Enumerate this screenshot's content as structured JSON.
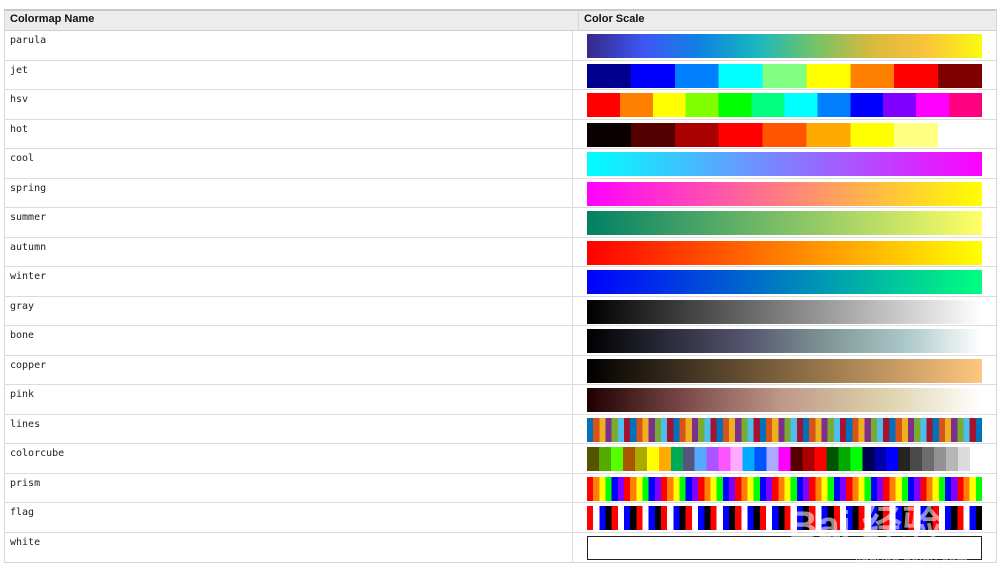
{
  "headers": {
    "name": "Colormap Name",
    "scale": "Color Scale"
  },
  "colormaps": [
    {
      "name": "parula",
      "kind": "gradient",
      "stops": [
        "#352a87",
        "#3e56f4",
        "#0f83e2",
        "#19b6c0",
        "#6fc46b",
        "#d5b93d",
        "#fbc33b",
        "#f9fb0e"
      ]
    },
    {
      "name": "jet",
      "kind": "stepped",
      "stops": [
        "#00008f",
        "#0000ff",
        "#0080ff",
        "#00ffff",
        "#80ff80",
        "#ffff00",
        "#ff8000",
        "#ff0000",
        "#800000"
      ]
    },
    {
      "name": "hsv",
      "kind": "stepped",
      "stops": [
        "#ff0000",
        "#ff8000",
        "#ffff00",
        "#80ff00",
        "#00ff00",
        "#00ff80",
        "#00ffff",
        "#0080ff",
        "#0000ff",
        "#8000ff",
        "#ff00ff",
        "#ff0080"
      ]
    },
    {
      "name": "hot",
      "kind": "stepped",
      "stops": [
        "#0b0000",
        "#550000",
        "#aa0000",
        "#ff0000",
        "#ff5500",
        "#ffaa00",
        "#ffff00",
        "#ffff80",
        "#ffffff"
      ]
    },
    {
      "name": "cool",
      "kind": "gradient",
      "stops": [
        "#00ffff",
        "#ff00ff"
      ]
    },
    {
      "name": "spring",
      "kind": "gradient",
      "stops": [
        "#ff00ff",
        "#ffff00"
      ]
    },
    {
      "name": "summer",
      "kind": "gradient",
      "stops": [
        "#008066",
        "#ffff66"
      ]
    },
    {
      "name": "autumn",
      "kind": "gradient",
      "stops": [
        "#ff0000",
        "#ffff00"
      ]
    },
    {
      "name": "winter",
      "kind": "gradient",
      "stops": [
        "#0000ff",
        "#00ff80"
      ]
    },
    {
      "name": "gray",
      "kind": "gradient",
      "stops": [
        "#000000",
        "#ffffff"
      ]
    },
    {
      "name": "bone",
      "kind": "gradient",
      "stops": [
        "#000000",
        "#2a2a3a",
        "#54546f",
        "#7e9494",
        "#a9c6c6",
        "#ffffff"
      ]
    },
    {
      "name": "copper",
      "kind": "gradient",
      "stops": [
        "#000000",
        "#ffc77f"
      ]
    },
    {
      "name": "pink",
      "kind": "gradient",
      "stops": [
        "#1e0000",
        "#7c4a4a",
        "#c09a8a",
        "#dcd1aa",
        "#ffffff"
      ]
    },
    {
      "name": "lines",
      "kind": "repeat",
      "count": 64,
      "stops": [
        "#0072bd",
        "#d95319",
        "#edb120",
        "#7e2f8e",
        "#77ac30",
        "#4dbeee",
        "#a2142f"
      ]
    },
    {
      "name": "colorcube",
      "kind": "stepped",
      "stops": [
        "#555500",
        "#55aa00",
        "#55ff00",
        "#aa5500",
        "#aaaa00",
        "#ffff00",
        "#ffaa00",
        "#00aa55",
        "#555580",
        "#55aaff",
        "#aa55ff",
        "#ff55ff",
        "#ffaaff",
        "#00aaff",
        "#0055ff",
        "#aaaaff",
        "#ff00ff",
        "#550000",
        "#aa0000",
        "#ff0000",
        "#005500",
        "#00aa00",
        "#00ff00",
        "#000055",
        "#0000aa",
        "#0000ff",
        "#242424",
        "#494949",
        "#6d6d6d",
        "#929292",
        "#b6b6b6",
        "#dbdbdb",
        "#ffffff"
      ]
    },
    {
      "name": "prism",
      "kind": "repeat",
      "count": 64,
      "stops": [
        "#ff0000",
        "#ff8000",
        "#ffff00",
        "#00ff00",
        "#0000ff",
        "#8000ff"
      ]
    },
    {
      "name": "flag",
      "kind": "repeat",
      "count": 64,
      "stops": [
        "#ff0000",
        "#ffffff",
        "#0000ff",
        "#000000"
      ]
    },
    {
      "name": "white",
      "kind": "solid",
      "stops": [
        "#ffffff"
      ]
    }
  ],
  "watermark": {
    "logo": "Bai 经验",
    "url": "jingyan.baidu.com"
  }
}
